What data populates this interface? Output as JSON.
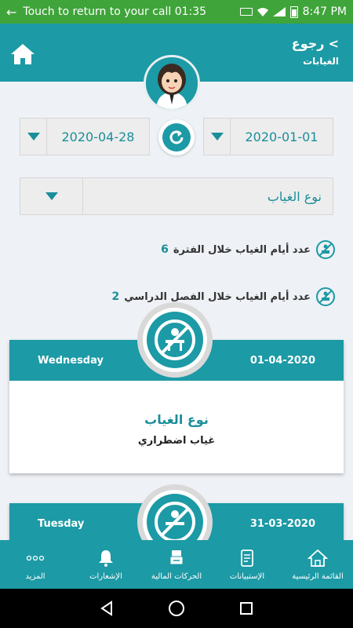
{
  "status_bar": {
    "call_text": "Touch to return to your call 01:35",
    "time": "8:47 PM"
  },
  "header": {
    "back_label": "رجوع",
    "title": "الغيابات"
  },
  "filters": {
    "from_date": "2020-01-01",
    "to_date": "2020-04-28",
    "absence_type_placeholder": "نوع الغياب"
  },
  "stats": {
    "period_label": "عدد أيام الغياب خلال الفترة",
    "period_value": "6",
    "semester_label": "عدد أيام الغياب خلال الفصل الدراسي",
    "semester_value": "2"
  },
  "records": [
    {
      "day": "Wednesday",
      "date": "01-04-2020",
      "type_title": "نوع الغياب",
      "type_value": "غياب اضطراري"
    },
    {
      "day": "Tuesday",
      "date": "31-03-2020"
    }
  ],
  "bottom_nav": [
    {
      "label": "القائمة الرئيسية",
      "icon": "home-icon"
    },
    {
      "label": "الإستبيانات",
      "icon": "survey-icon"
    },
    {
      "label": "الحركات المالية",
      "icon": "financial-icon"
    },
    {
      "label": "الإشعارات",
      "icon": "bell-icon"
    },
    {
      "label": "المزيد",
      "icon": "more-icon"
    }
  ],
  "colors": {
    "primary": "#1c9aa6",
    "status_bar": "#3fa43a",
    "background": "#eef1f5"
  }
}
